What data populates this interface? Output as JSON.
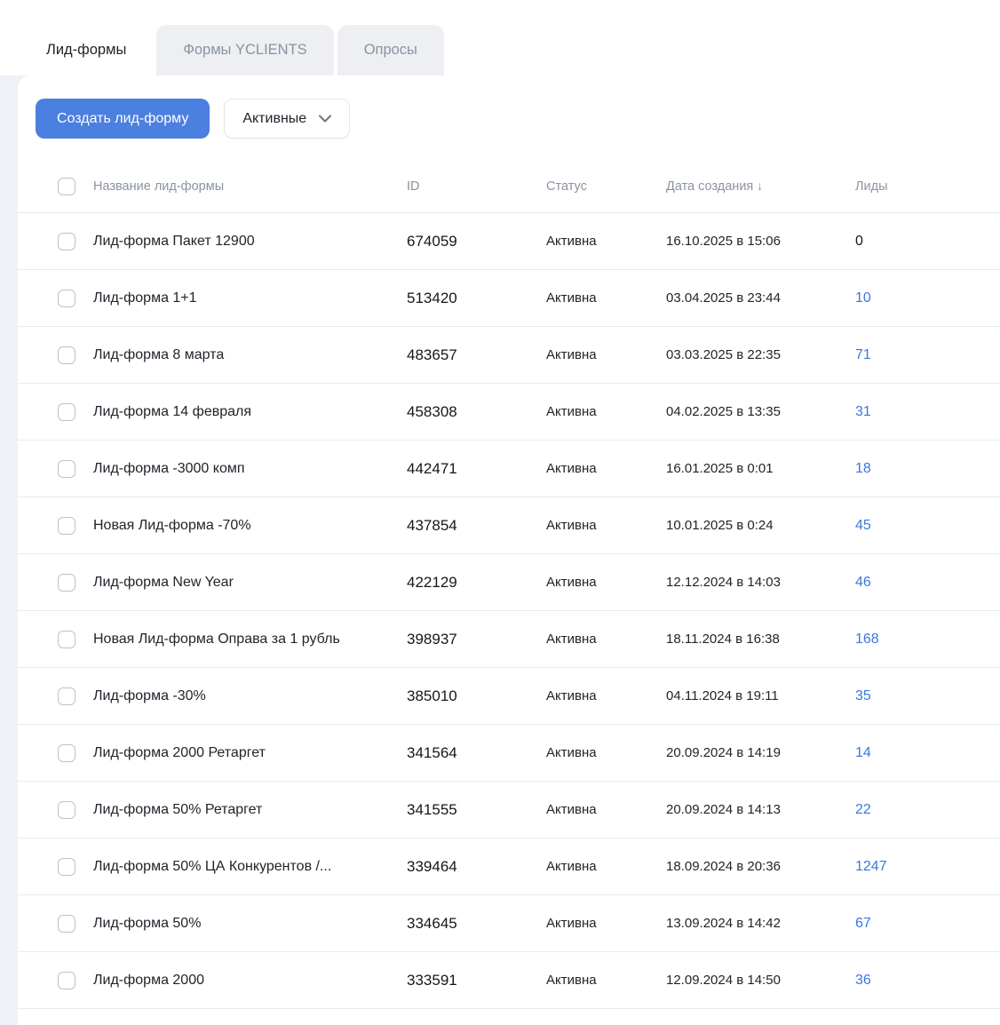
{
  "tabs": [
    {
      "label": "Лид-формы",
      "active": true
    },
    {
      "label": "Формы YCLIENTS",
      "active": false
    },
    {
      "label": "Опросы",
      "active": false
    }
  ],
  "toolbar": {
    "create_button_label": "Создать лид-форму",
    "filter_selected_value": "Активные"
  },
  "table": {
    "columns": {
      "name": "Название лид-формы",
      "id": "ID",
      "status": "Статус",
      "created": "Дата создания",
      "leads": "Лиды"
    },
    "sort_indicator": "↓",
    "rows": [
      {
        "name": "Лид-форма Пакет 12900",
        "id": "674059",
        "status": "Активна",
        "created": "16.10.2025 в 15:06",
        "leads": "0",
        "leads_is_link": false
      },
      {
        "name": "Лид-форма 1+1",
        "id": "513420",
        "status": "Активна",
        "created": "03.04.2025 в 23:44",
        "leads": "10",
        "leads_is_link": true
      },
      {
        "name": "Лид-форма 8 марта",
        "id": "483657",
        "status": "Активна",
        "created": "03.03.2025 в 22:35",
        "leads": "71",
        "leads_is_link": true
      },
      {
        "name": "Лид-форма 14 февраля",
        "id": "458308",
        "status": "Активна",
        "created": "04.02.2025 в 13:35",
        "leads": "31",
        "leads_is_link": true
      },
      {
        "name": "Лид-форма -3000 комп",
        "id": "442471",
        "status": "Активна",
        "created": "16.01.2025 в 0:01",
        "leads": "18",
        "leads_is_link": true
      },
      {
        "name": "Новая Лид-форма -70%",
        "id": "437854",
        "status": "Активна",
        "created": "10.01.2025 в 0:24",
        "leads": "45",
        "leads_is_link": true
      },
      {
        "name": "Лид-форма New Year",
        "id": "422129",
        "status": "Активна",
        "created": "12.12.2024 в 14:03",
        "leads": "46",
        "leads_is_link": true
      },
      {
        "name": "Новая Лид-форма Оправа за 1 рубль",
        "id": "398937",
        "status": "Активна",
        "created": "18.11.2024 в 16:38",
        "leads": "168",
        "leads_is_link": true
      },
      {
        "name": "Лид-форма -30%",
        "id": "385010",
        "status": "Активна",
        "created": "04.11.2024 в 19:11",
        "leads": "35",
        "leads_is_link": true
      },
      {
        "name": "Лид-форма 2000 Ретаргет",
        "id": "341564",
        "status": "Активна",
        "created": "20.09.2024 в 14:19",
        "leads": "14",
        "leads_is_link": true
      },
      {
        "name": "Лид-форма 50% Ретаргет",
        "id": "341555",
        "status": "Активна",
        "created": "20.09.2024 в 14:13",
        "leads": "22",
        "leads_is_link": true
      },
      {
        "name": "Лид-форма 50% ЦА Конкурентов /...",
        "id": "339464",
        "status": "Активна",
        "created": "18.09.2024 в 20:36",
        "leads": "1247",
        "leads_is_link": true
      },
      {
        "name": "Лид-форма 50%",
        "id": "334645",
        "status": "Активна",
        "created": "13.09.2024 в 14:42",
        "leads": "67",
        "leads_is_link": true
      },
      {
        "name": "Лид-форма 2000",
        "id": "333591",
        "status": "Активна",
        "created": "12.09.2024 в 14:50",
        "leads": "36",
        "leads_is_link": true
      }
    ]
  },
  "colors": {
    "accent_blue": "#4b7fe0",
    "link_blue": "#3b77dd",
    "page_background": "#eef1f5",
    "tab_inactive_background": "#edeff3",
    "header_text_gray": "#8a93a1"
  }
}
